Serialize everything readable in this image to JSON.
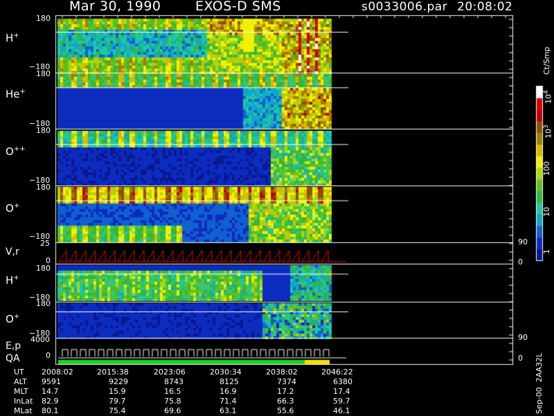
{
  "header": {
    "date": "Mar 30, 1990",
    "instrument": "EXOS-D SMS",
    "file": "s0033006.par",
    "time": "20:08:02"
  },
  "panels": [
    {
      "id": "h-plus",
      "label": "H",
      "sup": "+",
      "top": "180",
      "bottom": "−180"
    },
    {
      "id": "he-plus",
      "label": "He",
      "sup": "+",
      "top": "180",
      "bottom": "−180"
    },
    {
      "id": "o-plusplus",
      "label": "O",
      "sup": "++",
      "top": "180",
      "bottom": "−180"
    },
    {
      "id": "o-plus",
      "label": "O",
      "sup": "+",
      "top": "180",
      "bottom": "−180"
    },
    {
      "id": "vr",
      "label": "V,r",
      "top": "25",
      "mid": "0",
      "right_top": "90",
      "right_bottom": "0"
    },
    {
      "id": "h-plus-2",
      "label": "H",
      "sup": "+",
      "top": "180",
      "bottom": "−180"
    },
    {
      "id": "o-plus-2",
      "label": "O",
      "sup": "+",
      "top": "180",
      "bottom": "−180"
    },
    {
      "id": "ep-qa",
      "label1": "E,p",
      "label2": "QA",
      "top": "4000",
      "mid": "0",
      "right_top": "90",
      "right_bottom": "0"
    }
  ],
  "colorbar": {
    "unit": "Ct/Smp",
    "labels": [
      "10^4",
      "10^3",
      "100",
      "10",
      "1"
    ]
  },
  "footer_label": "Sep-00  2AA32L",
  "chart_data": {
    "type": "heatmap",
    "title": "Mar 30, 1990   EXOS-D SMS",
    "x_ticks": [
      "2008:02",
      "2015:38",
      "2023:06",
      "2030:34",
      "2038:02",
      "2046:22"
    ],
    "rows": [
      {
        "name": "UT",
        "values": [
          "2008:02",
          "2015:38",
          "2023:06",
          "2030:34",
          "2038:02",
          "2046:22"
        ]
      },
      {
        "name": "ALT",
        "values": [
          "9591",
          "9229",
          "8743",
          "8125",
          "7374",
          "6380"
        ]
      },
      {
        "name": "MLT",
        "values": [
          "14.7",
          "15.9",
          "16.5",
          "16.9",
          "17.2",
          "17.4"
        ]
      },
      {
        "name": "InLat",
        "values": [
          "82.9",
          "79.7",
          "75.8",
          "71.4",
          "66.3",
          "59.7"
        ]
      },
      {
        "name": "MLat",
        "values": [
          "80.1",
          "75.4",
          "69.6",
          "63.1",
          "55.6",
          "46.1"
        ]
      }
    ],
    "colorscale": [
      "#0a1890",
      "#0c2cc0",
      "#1060d0",
      "#10a8c8",
      "#20c8a0",
      "#30b840",
      "#60c020",
      "#a8d810",
      "#f0f000",
      "#d8b800",
      "#a08000",
      "#905000",
      "#c00000",
      "#e00000",
      "#ffffff"
    ]
  }
}
